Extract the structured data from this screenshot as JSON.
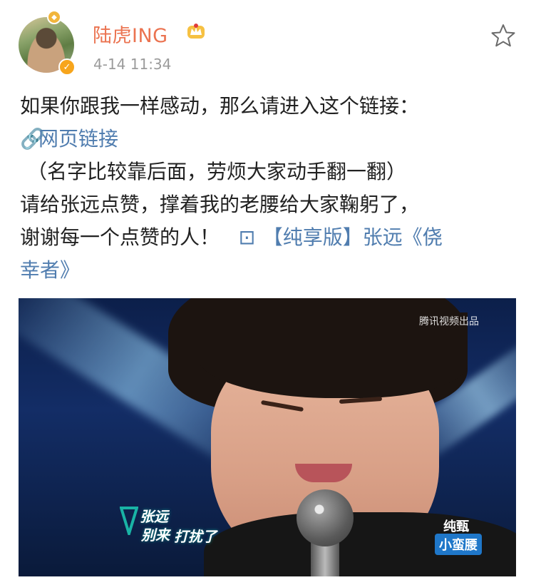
{
  "post": {
    "user_name": "陆虎ING",
    "timestamp": "4-14 11:34",
    "crown_icon": "crown-icon",
    "favorite_icon": "star-icon"
  },
  "content": {
    "line1": "如果你跟我一样感动，那么请进入这个链接：",
    "link_label": "网页链接",
    "line3": "（名字比较靠后面，劳烦大家动手翻一翻）",
    "line4": "请给张远点赞，撑着我的老腰给大家鞠躬了，",
    "line5_text": "谢谢每一个点赞的人！",
    "video_link_part1": "【纯享版】张远《侥",
    "video_link_part2": "幸者》"
  },
  "media": {
    "watermark": "腾讯视频出品",
    "caption_singer": "张远",
    "caption_song_prefix": "别来",
    "caption_song": "打扰了",
    "sponsor_line1": "纯甄",
    "sponsor_line2": "小蛮腰"
  },
  "colors": {
    "name": "#eb7350",
    "link": "#507daf",
    "time": "#9b9b9b"
  }
}
